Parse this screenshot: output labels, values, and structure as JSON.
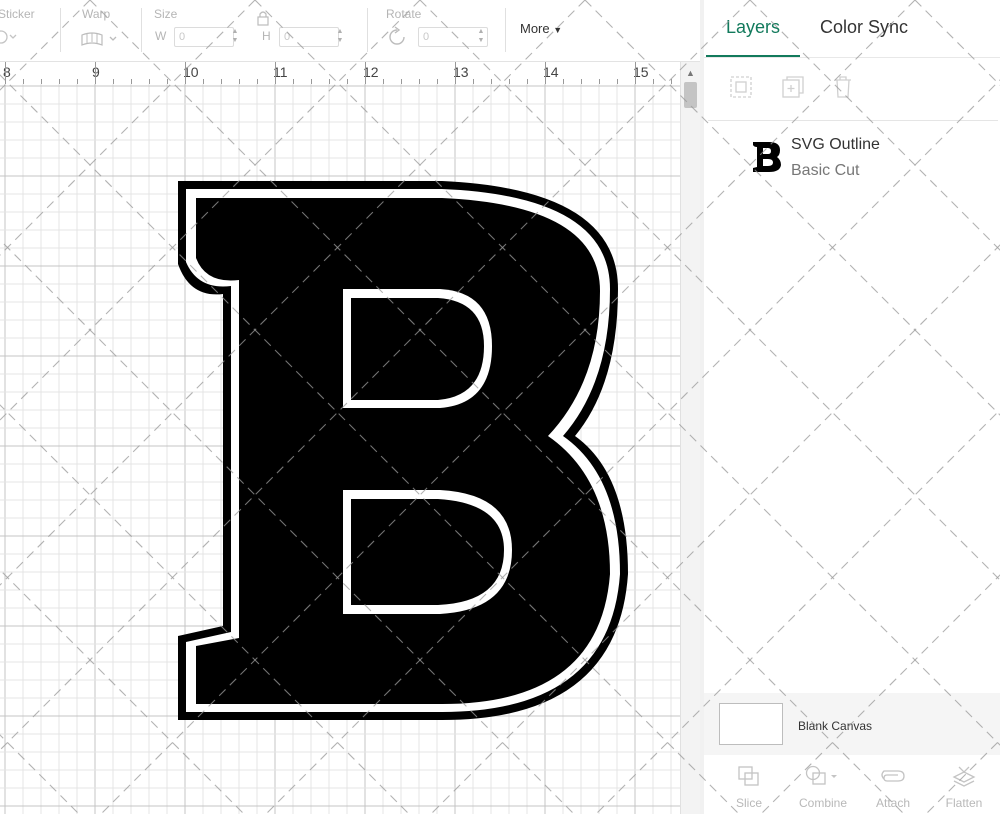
{
  "toolbar": {
    "sticker_label": "Sticker",
    "warp_label": "Warp",
    "size_label": "Size",
    "width_letter": "W",
    "width_value": "0",
    "height_letter": "H",
    "height_value": "0",
    "rotate_label": "Rotate",
    "rotate_value": "0",
    "more_label": "More"
  },
  "ruler": {
    "numbers": [
      "8",
      "9",
      "10",
      "11",
      "12",
      "13",
      "14",
      "15"
    ]
  },
  "canvas": {
    "letter": "B",
    "letter_color": "#000000",
    "outline_color": "#ffffff",
    "grid_color": "#d9d9d9"
  },
  "panel": {
    "tabs": [
      {
        "label": "Layers",
        "active": true
      },
      {
        "label": "Color Sync",
        "active": false
      }
    ],
    "layer_tools": [
      "group-icon",
      "duplicate-icon",
      "delete-icon"
    ],
    "layers": [
      {
        "name": "SVG Outline",
        "type": "Basic Cut"
      }
    ],
    "blank_canvas_label": "Blank Canvas",
    "bottom_tools": [
      {
        "label": "Slice",
        "icon": "slice-icon"
      },
      {
        "label": "Combine",
        "icon": "combine-icon"
      },
      {
        "label": "Attach",
        "icon": "attach-icon"
      },
      {
        "label": "Flatten",
        "icon": "flatten-icon"
      }
    ]
  },
  "colors": {
    "accent": "#127a5c"
  }
}
